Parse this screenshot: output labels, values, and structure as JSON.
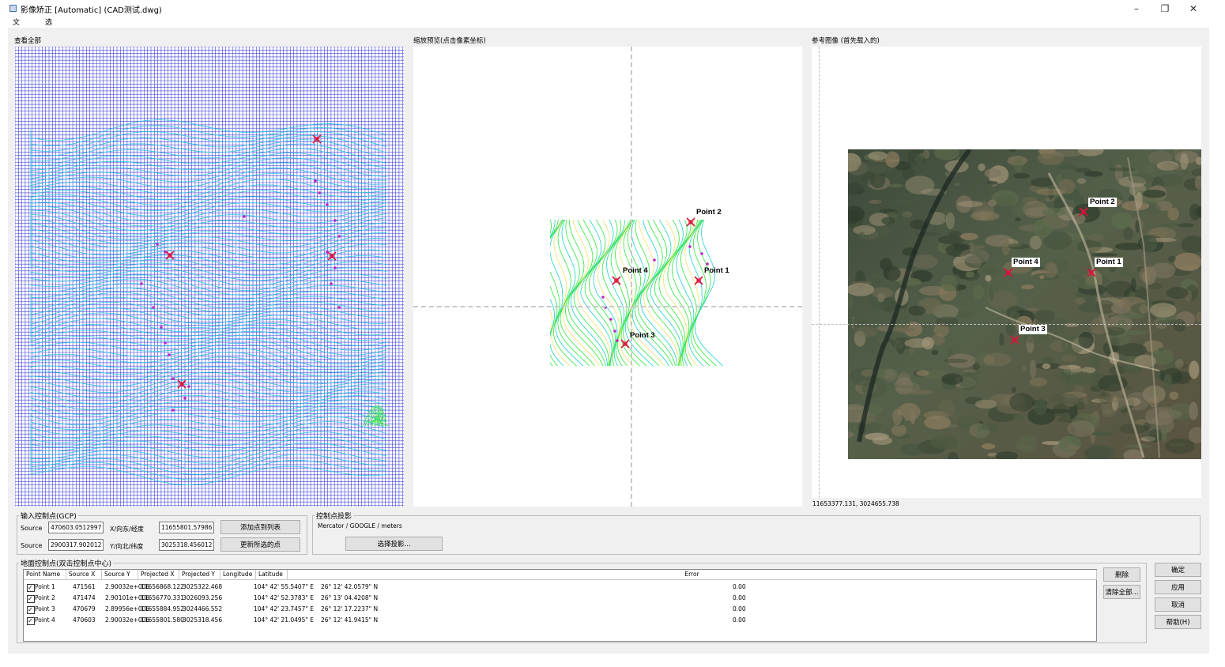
{
  "window": {
    "title": "影像矫正 [Automatic] (CAD测试.dwg)",
    "minimize": "–",
    "restore": "❐",
    "close": "✕"
  },
  "menu": [
    {
      "label": "文件(F)"
    },
    {
      "label": "选项 (O)"
    }
  ],
  "panels": {
    "overview_label": "查看全部",
    "zoom_label": "缩放预览(点击像素坐标)",
    "reference_label": "参考图像 (首先载入的)",
    "coord_readout": "11653377.131, 3024655.738"
  },
  "point_labels": {
    "p1": "Point 1",
    "p2": "Point 2",
    "p3": "Point 3",
    "p4": "Point 4"
  },
  "gcp_input": {
    "title": "输入控制点(GCP)",
    "source_label": "Source",
    "source_x": "470603.0512997",
    "source_y": "2900317.902012",
    "x_label": "X/向东/经度",
    "y_label": "Y/向北/纬度",
    "proj_x": "11655801.57986",
    "proj_y": "3025318.456012",
    "add_button": "添加点到列表",
    "update_button": "更新所选的点"
  },
  "projection": {
    "title": "控制点投影",
    "value": "Mercator / GOOGLE / meters",
    "select_button": "选择投影..."
  },
  "gcp_list": {
    "title": "地面控制点(双击控制点中心)",
    "columns": [
      "Point Name",
      "Source X",
      "Source Y",
      "Projected X",
      "Projected Y",
      "Longitude",
      "Latitude",
      "Error"
    ],
    "rows": [
      {
        "checked": true,
        "name": "Point 1",
        "sx": "471561",
        "sy": "2.90032e+006",
        "px": "11656868.122",
        "py": "3025322.468",
        "lon": "104° 42' 55.5407\" E",
        "lat": "26° 12' 42.0579\" N",
        "err": "0.00"
      },
      {
        "checked": true,
        "name": "Point 2",
        "sx": "471474",
        "sy": "2.90101e+006",
        "px": "11656770.331",
        "py": "3026093.256",
        "lon": "104° 42' 52.3783\" E",
        "lat": "26° 13' 04.4208\" N",
        "err": "0.00"
      },
      {
        "checked": true,
        "name": "Point 3",
        "sx": "470679",
        "sy": "2.89956e+006",
        "px": "11655884.952",
        "py": "3024466.552",
        "lon": "104° 42' 23.7457\" E",
        "lat": "26° 12' 17.2237\" N",
        "err": "0.00"
      },
      {
        "checked": true,
        "name": "Point 4",
        "sx": "470603",
        "sy": "2.90032e+006",
        "px": "11655801.580",
        "py": "3025318.456",
        "lon": "104° 42' 21.0495\" E",
        "lat": "26° 12' 41.9415\" N",
        "err": "0.00"
      }
    ],
    "delete_button": "删除",
    "remove_all_button": "清除全部..."
  },
  "dialog_buttons": {
    "ok": "确定",
    "apply": "应用",
    "cancel": "取消",
    "help": "帮助(H)"
  },
  "colors": {
    "grid": "#2c2cd8",
    "contour_cyan": "#22c6e0",
    "contour_green": "#2ee83a",
    "marker": "#e0103a",
    "magenta": "#c023c8"
  }
}
